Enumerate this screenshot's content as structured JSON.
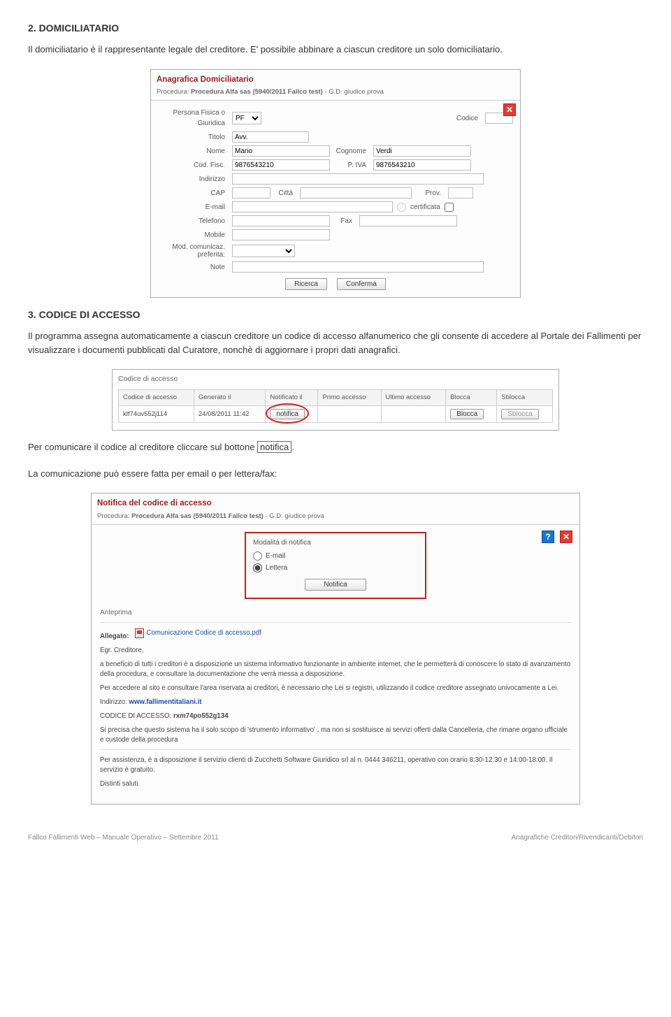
{
  "section2": {
    "heading": "2.   DOMICILIATARIO",
    "para": "Il domiciliatario è il rappresentante legale del creditore. E' possibile abbinare a ciascun creditore un solo domiciliatario."
  },
  "panel1": {
    "title": "Anagrafica Domiciliatario",
    "sub_prefix": "Procedura: ",
    "sub_bold": "Procedura Alfa sas (5940/2011 Fallco test)",
    "sub_suffix": " - G.D. giudice prova",
    "close": "✕",
    "labels": {
      "persona": "Persona Fisica o Giuridica",
      "persona_val": "PF",
      "codice": "Codice",
      "titolo": "Titolo",
      "titolo_val": "Avv.",
      "nome": "Nome",
      "nome_val": "Mario",
      "cognome": "Cognome",
      "cognome_val": "Verdi",
      "codfisc": "Cod. Fisc.",
      "codfisc_val": "9876543210",
      "piva": "P. IVA",
      "piva_val": "9876543210",
      "indirizzo": "Indirizzo",
      "cap": "CAP",
      "citta": "Città",
      "prov": "Prov.",
      "email": "E-mail",
      "certificata": "certificata",
      "telefono": "Telefono",
      "fax": "Fax",
      "mobile": "Mobile",
      "modcom": "Mod. comunicaz. preferita:",
      "note": "Note"
    },
    "buttons": {
      "ricerca": "Ricerca",
      "conferma": "Conferma"
    }
  },
  "section3": {
    "heading": "3.   CODICE DI ACCESSO",
    "para": "Il programma assegna automaticamente a ciascun creditore un codice di accesso alfanumerico che gli consente di accedere al Portale dei Fallimenti per visualizzare i documenti pubblicati dal Curatore, nonchè di aggiornare i propri dati anagrafici."
  },
  "panel2": {
    "group": "Codice di accesso",
    "headers": [
      "Codice di accesso",
      "Generato il",
      "Notificato il",
      "Primo accesso",
      "Ultimo accesso",
      "Blocca",
      "Sblocca"
    ],
    "row": {
      "codice": "klf74uv552j114",
      "generato": "24/08/2011 11:42",
      "notifica_btn": "notifica",
      "primo": "",
      "ultimo": "",
      "blocca_btn": "Blocca",
      "sblocca_btn": "Sblocca"
    }
  },
  "para_notifica_pre": "Per comunicare il codice al creditore cliccare sul bottone ",
  "para_notifica_btn": "notifica",
  "para_notifica_post": ".",
  "para_email": "La comunicazione può essere fatta per email o per lettera/fax:",
  "panel3": {
    "title": "Notifica del codice di accesso",
    "sub_prefix": "Procedura: ",
    "sub_bold": "Procedura Alfa sas (5940/2011 Fallco test)",
    "sub_suffix": " - G.D. giudice prova",
    "help": "?",
    "close": "✕",
    "modalita_title": "Modalità di notifica",
    "opt_email": "E-mail",
    "opt_lettera": "Lettera",
    "notifica_btn": "Notifica",
    "anteprima": "Anteprima",
    "allegato_lbl": "Allegato:",
    "allegato_name": "Comunicazione Codice di accesso.pdf",
    "letter": {
      "l1": "Egr. Creditore,",
      "l2": "a beneficio di tutti i creditori è a disposizione un sistema informativo funzionante in ambiente internet, che le permetterà di conoscere lo stato di avanzamento della procedura, e consultare la documentazione che verrà messa a disposizione.",
      "l3": "Per accedere al sito e consultare l'area riservata ai creditori, è necessario che Lei si registri, utilizzando il codice creditore assegnato univocamente a Lei.",
      "l4_lbl": "Indirizzo: ",
      "l4_link": "www.fallimentitaliani.it",
      "l5_lbl": "CODICE DI ACCESSO: ",
      "l5_code": "rxm74po552g134",
      "l6": "Si precisa che questo sistema ha il solo scopo di 'strumento informativo' , ma non si sostituisce ai servizi offerti dalla Cancelleria, che rimane organo ufficiale e custode della procedura",
      "l7": "Per assistenza, è a disposizione il servizio clienti di Zucchetti Software Giuridico srl al n. 0444 346211, operativo con orario 8:30-12:30 e 14:00-18:00. Il servizio è gratuito.",
      "l8": "Distinti saluti."
    }
  },
  "footer": {
    "left": "Fallco Fallimenti Web – Manuale Operativo – Settembre 2011",
    "right": "Anagrafiche Creditori/Rivendicanti/Debitori"
  }
}
